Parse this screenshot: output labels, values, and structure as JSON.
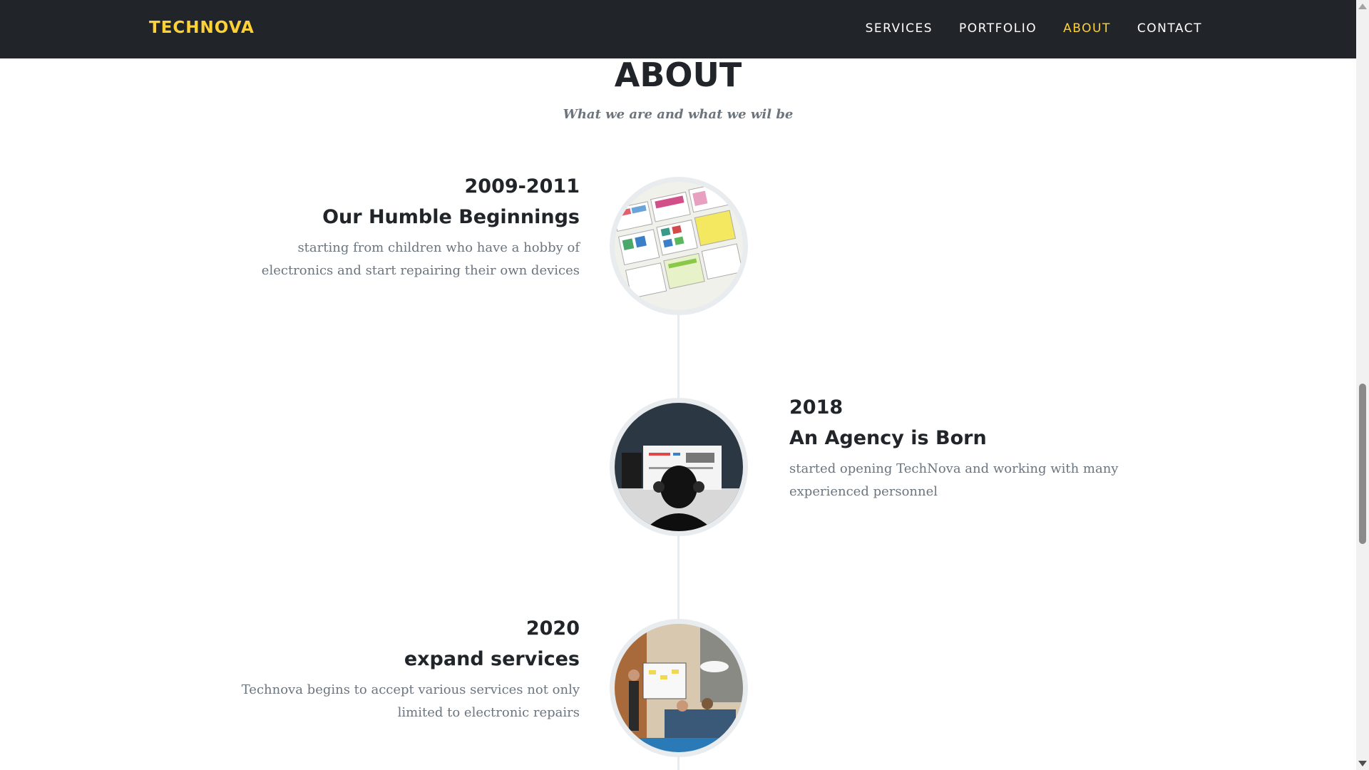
{
  "navbar": {
    "brand": "TECHNOVA",
    "links": [
      {
        "label": "SERVICES",
        "active": false
      },
      {
        "label": "PORTFOLIO",
        "active": false
      },
      {
        "label": "ABOUT",
        "active": true
      },
      {
        "label": "CONTACT",
        "active": false
      }
    ]
  },
  "about": {
    "heading": "ABOUT",
    "subheading": "What we are and what we wil be",
    "timeline": [
      {
        "date": "2009-2011",
        "title": "Our Humble Beginnings",
        "body_line1": "starting from children who have a hobby of",
        "body_line2": "electronics and start repairing their own devices",
        "image": "wireframe-sketches-image"
      },
      {
        "date": "2018",
        "title": "An Agency is Born",
        "body_line1": "started opening TechNova and working with many",
        "body_line2": "experienced personnel",
        "image": "designer-at-monitor-image"
      },
      {
        "date": "2020",
        "title": "expand services",
        "body_line1": "Technova begins to accept various services not only",
        "body_line2": "limited to electronic repairs",
        "image": "team-meeting-image"
      }
    ]
  },
  "colors": {
    "navbar_bg": "#212529",
    "accent": "#fed136",
    "muted_text": "#6c757d",
    "timeline_border": "#e9ecef"
  }
}
